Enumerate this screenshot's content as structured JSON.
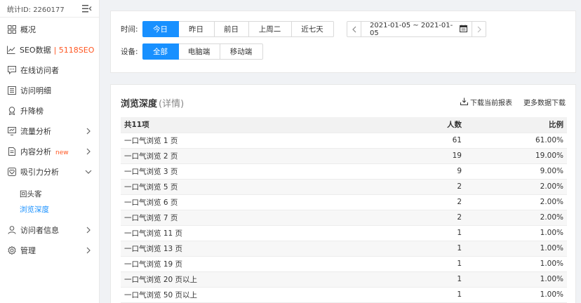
{
  "sidebar": {
    "stat_id": "统计ID: 2260177",
    "items": [
      {
        "label": "概况",
        "icon": "grid-icon"
      },
      {
        "label": "SEO数据",
        "extra": "| 5118SEO",
        "icon": "chart-line-icon"
      },
      {
        "label": "在线访问者",
        "icon": "chat-icon"
      },
      {
        "label": "访问明细",
        "icon": "list-icon"
      },
      {
        "label": "升降榜",
        "icon": "medal-icon"
      },
      {
        "label": "流量分析",
        "icon": "monitor-icon"
      },
      {
        "label": "内容分析",
        "badge": "new",
        "icon": "file-icon"
      },
      {
        "label": "吸引力分析",
        "icon": "heart-icon"
      }
    ],
    "sub_items": [
      {
        "label": "回头客"
      },
      {
        "label": "浏览深度"
      }
    ],
    "bottom_items": [
      {
        "label": "访问者信息",
        "icon": "user-icon"
      },
      {
        "label": "管理",
        "icon": "gear-icon"
      }
    ]
  },
  "filter": {
    "time_label": "时间:",
    "time_buttons": [
      "今日",
      "昨日",
      "前日",
      "上周二",
      "近七天"
    ],
    "device_label": "设备:",
    "device_buttons": [
      "全部",
      "电脑端",
      "移动端"
    ],
    "date_range": "2021-01-05 ~ 2021-01-05"
  },
  "table_panel": {
    "title": "浏览深度",
    "detail": "(详情)",
    "download_current": "下载当前报表",
    "more_download": "更多数据下载",
    "headers": [
      "共11项",
      "人数",
      "比例"
    ],
    "rows": [
      [
        "一口气浏览 1 页",
        "61",
        "61.00%"
      ],
      [
        "一口气浏览 2 页",
        "19",
        "19.00%"
      ],
      [
        "一口气浏览 3 页",
        "9",
        "9.00%"
      ],
      [
        "一口气浏览 5 页",
        "2",
        "2.00%"
      ],
      [
        "一口气浏览 6 页",
        "2",
        "2.00%"
      ],
      [
        "一口气浏览 7 页",
        "2",
        "2.00%"
      ],
      [
        "一口气浏览 11 页",
        "1",
        "1.00%"
      ],
      [
        "一口气浏览 13 页",
        "1",
        "1.00%"
      ],
      [
        "一口气浏览 19 页",
        "1",
        "1.00%"
      ],
      [
        "一口气浏览 20 页以上",
        "1",
        "1.00%"
      ],
      [
        "一口气浏览 50 页以上",
        "1",
        "1.00%"
      ]
    ]
  },
  "colors": {
    "accent": "#1890ff",
    "tag": "#ff5722"
  }
}
